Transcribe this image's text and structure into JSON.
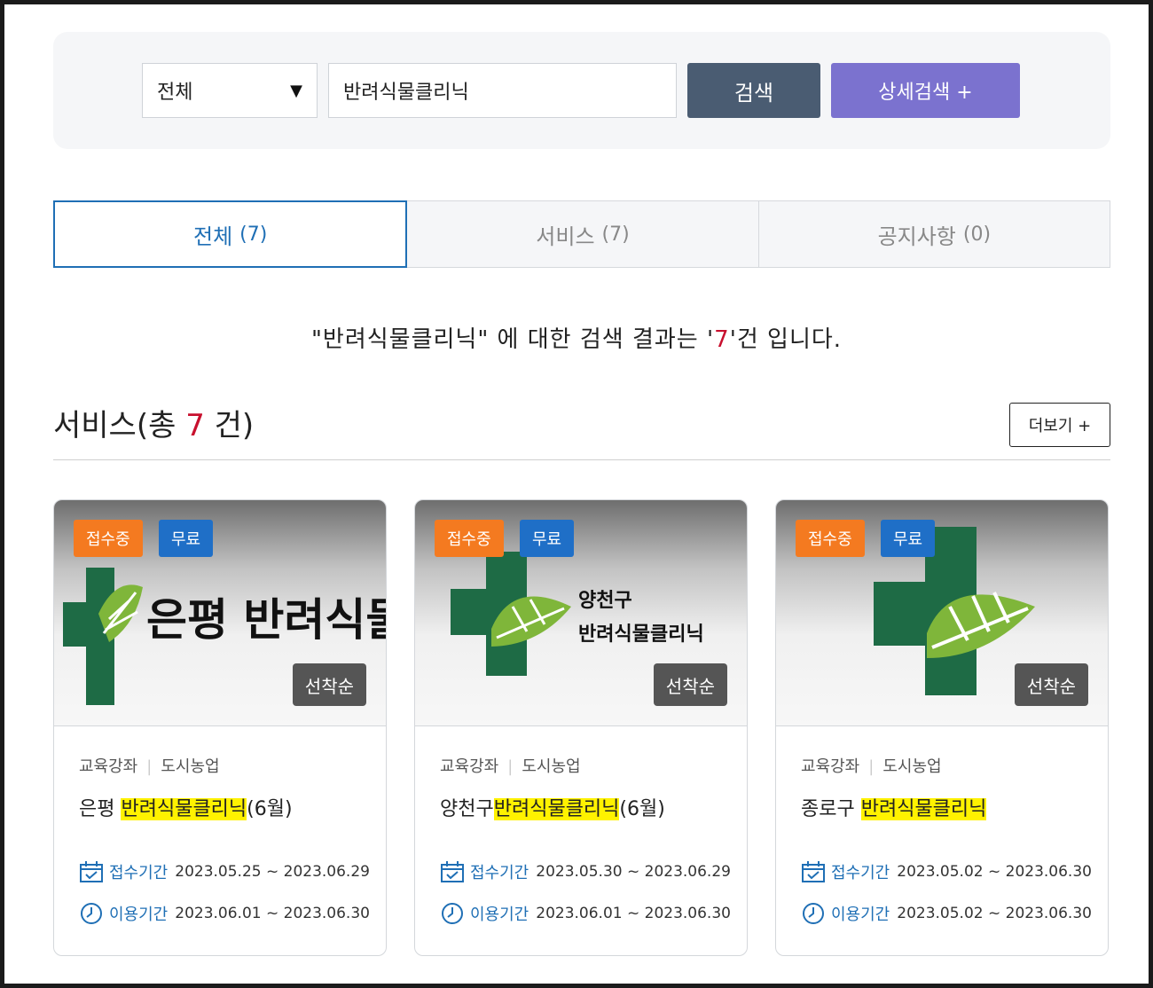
{
  "search": {
    "category_selected": "전체",
    "query": "반려식물클리닉",
    "search_label": "검색",
    "advanced_label": "상세검색 +"
  },
  "tabs": [
    {
      "label": "전체",
      "count": "(7)"
    },
    {
      "label": "서비스",
      "count": "(7)"
    },
    {
      "label": "공지사항",
      "count": "(0)"
    }
  ],
  "result": {
    "prefix": "\"반려식물클리닉\" 에 대한 검색 결과는 '",
    "count": "7",
    "suffix": "'건 입니다."
  },
  "section": {
    "title_prefix": "서비스(총 ",
    "count": "7",
    "title_suffix": " 건)",
    "more_label": "더보기 +"
  },
  "cards": [
    {
      "status": "접수중",
      "fee": "무료",
      "order": "선착순",
      "category": "교육강좌",
      "subcategory": "도시농업",
      "title_prefix": "은평 ",
      "title_highlight": "반려식물클리닉",
      "title_suffix": "(6월)",
      "logo_lines": [
        "은평 반려식물 클리닉"
      ],
      "apply_label": "접수기간",
      "apply_period": "2023.05.25 ~ 2023.06.29",
      "use_label": "이용기간",
      "use_period": "2023.06.01 ~ 2023.06.30"
    },
    {
      "status": "접수중",
      "fee": "무료",
      "order": "선착순",
      "category": "교육강좌",
      "subcategory": "도시농업",
      "title_prefix": "양천구",
      "title_highlight": "반려식물클리닉",
      "title_suffix": "(6월)",
      "logo_lines": [
        "양천구",
        "반려식물클리닉"
      ],
      "apply_label": "접수기간",
      "apply_period": "2023.05.30 ~ 2023.06.29",
      "use_label": "이용기간",
      "use_period": "2023.06.01 ~ 2023.06.30"
    },
    {
      "status": "접수중",
      "fee": "무료",
      "order": "선착순",
      "category": "교육강좌",
      "subcategory": "도시농업",
      "title_prefix": "종로구 ",
      "title_highlight": "반려식물클리닉",
      "title_suffix": "",
      "logo_lines": [],
      "apply_label": "접수기간",
      "apply_period": "2023.05.02 ~ 2023.06.30",
      "use_label": "이용기간",
      "use_period": "2023.05.02 ~ 2023.06.30"
    }
  ],
  "colors": {
    "primary_blue": "#1f6fb5",
    "search_button": "#4a5c72",
    "advanced_button": "#7b72cf",
    "badge_status": "#f47a20",
    "badge_fee": "#1f6fc7",
    "count_red": "#c8102e",
    "highlight": "#fff200",
    "logo_dark_green": "#1e6b45",
    "logo_leaf_green": "#7fb63a"
  },
  "icons": {
    "dropdown": "caret-down-icon",
    "apply_period": "calendar-check-icon",
    "use_period": "clock-icon",
    "thumbnail_logo": "green-cross-leaf-logo"
  }
}
